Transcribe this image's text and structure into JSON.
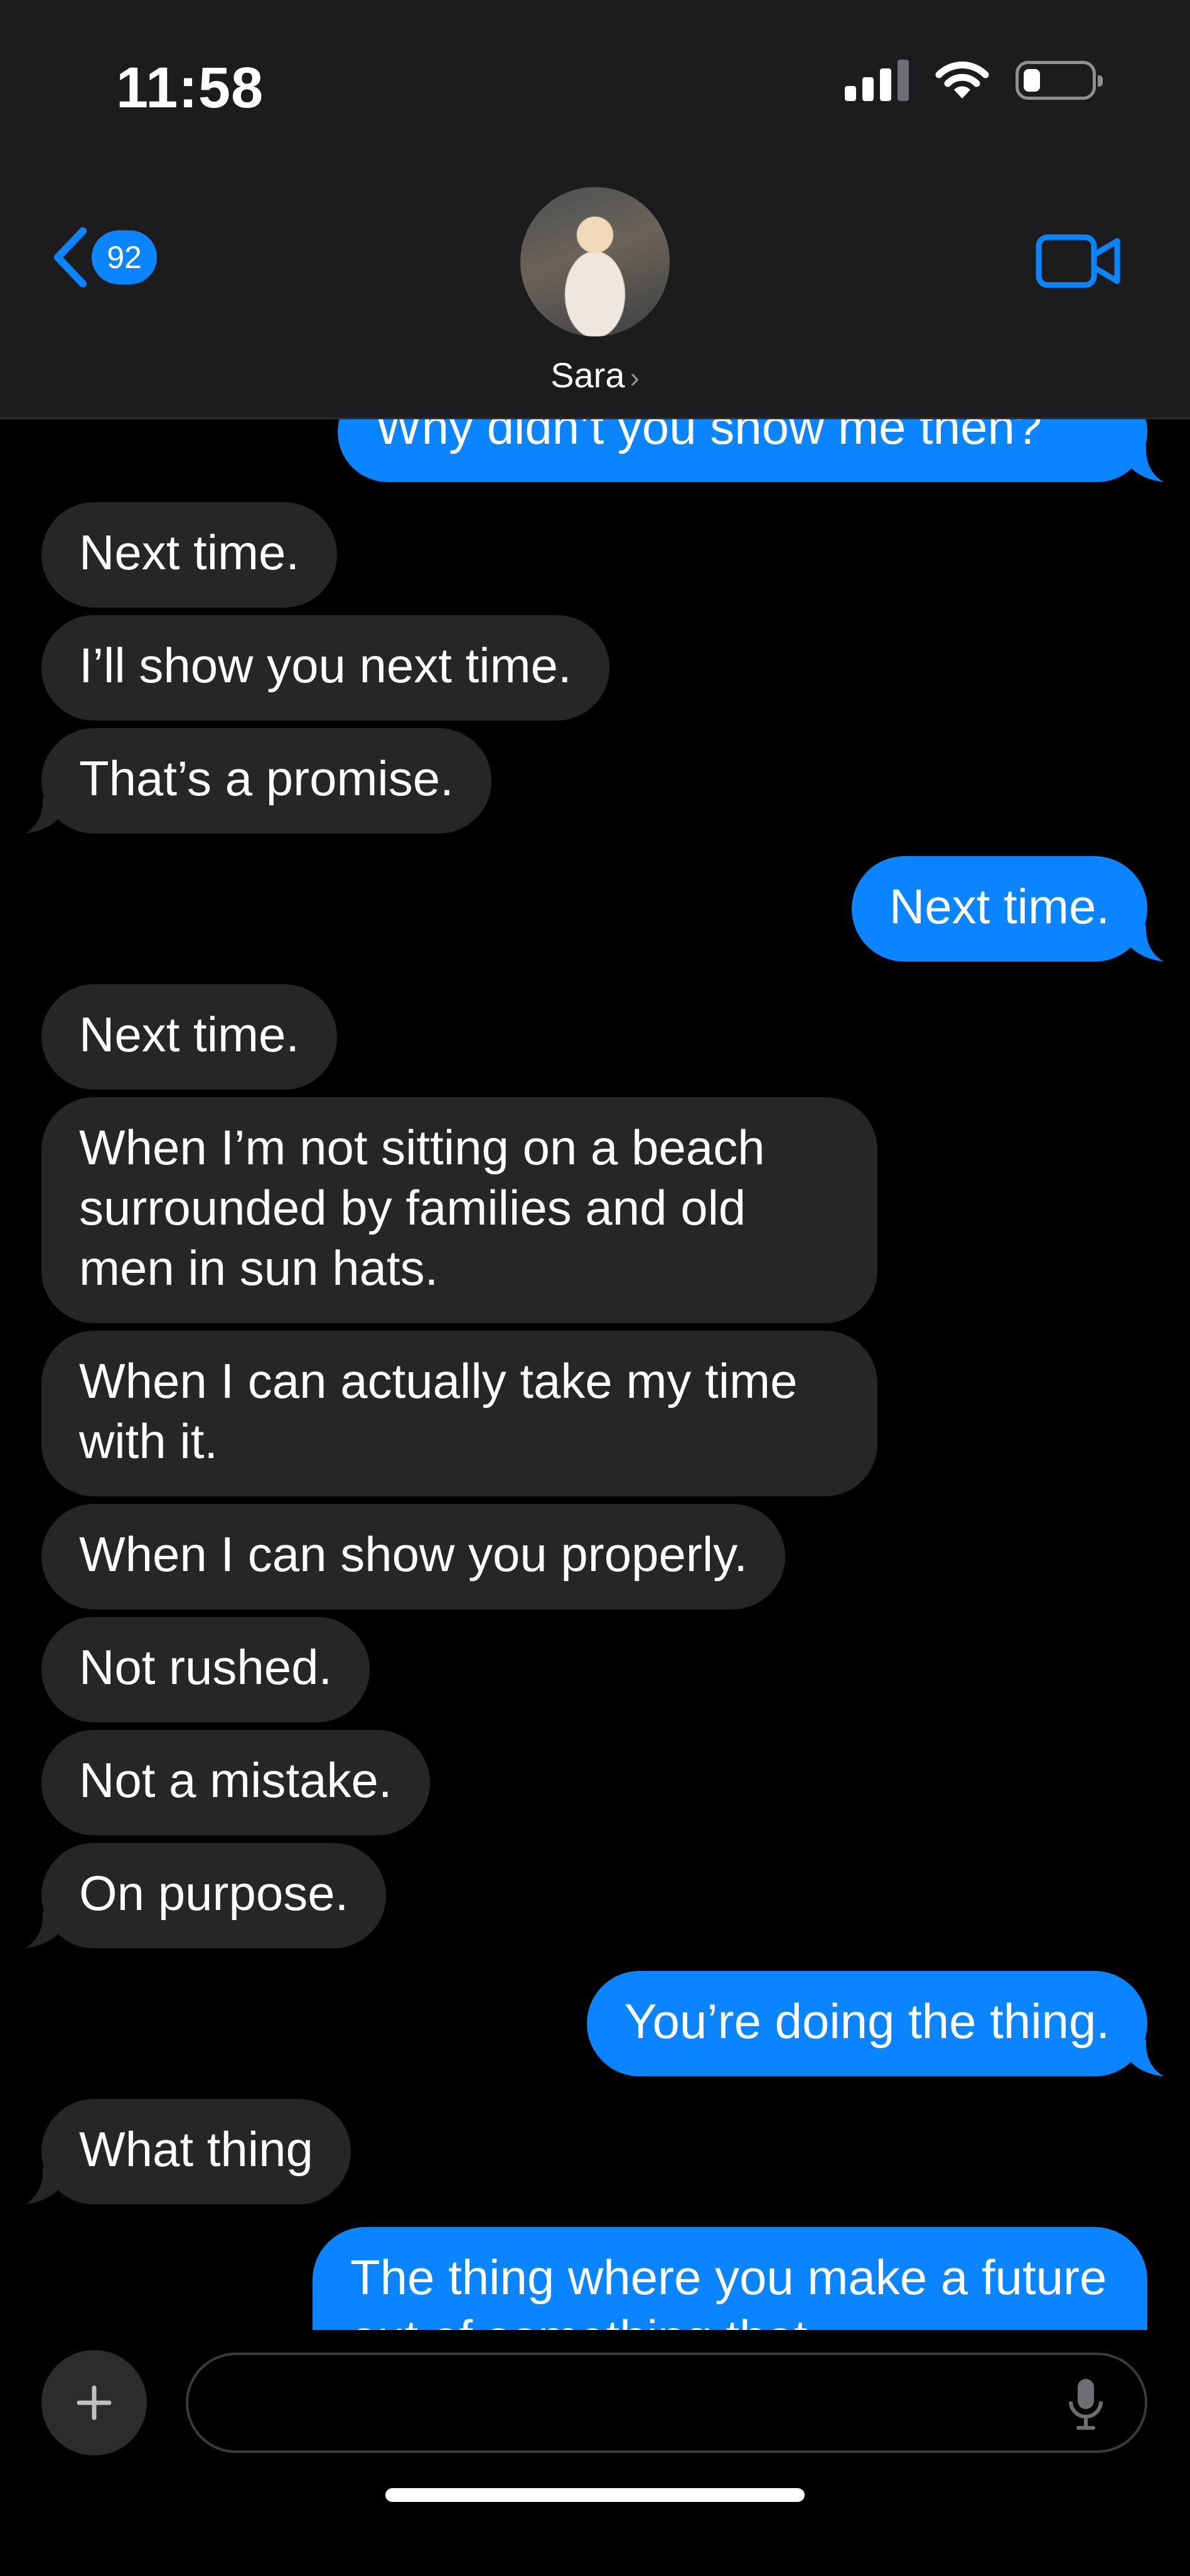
{
  "status_bar": {
    "time": "11:58"
  },
  "header": {
    "back_badge": "92",
    "contact_name": "Sara",
    "accent_color": "#0a84ff"
  },
  "messages": [
    {
      "dir": "out",
      "text": "Why didn’t you show me then?"
    },
    {
      "dir": "in",
      "text": "Next time."
    },
    {
      "dir": "in",
      "text": "I’ll show you next time."
    },
    {
      "dir": "in",
      "text": "That’s a promise."
    },
    {
      "dir": "out",
      "text": "Next time."
    },
    {
      "dir": "in",
      "text": "Next time."
    },
    {
      "dir": "in",
      "text": "When I’m not sitting on a beach surrounded by families and old men in sun hats."
    },
    {
      "dir": "in",
      "text": "When I can actually take my time with it."
    },
    {
      "dir": "in",
      "text": "When I can show you properly."
    },
    {
      "dir": "in",
      "text": "Not rushed."
    },
    {
      "dir": "in",
      "text": "Not a mistake."
    },
    {
      "dir": "in",
      "text": "On purpose."
    },
    {
      "dir": "out",
      "text": "You’re doing the thing."
    },
    {
      "dir": "in",
      "text": "What thing"
    },
    {
      "dir": "out",
      "text": "The thing where you make a future out of something that"
    }
  ],
  "composer": {
    "placeholder": ""
  },
  "icons": [
    "back-chevron-icon",
    "video-camera-icon",
    "plus-icon",
    "microphone-icon",
    "cellular-signal-icon",
    "wifi-icon",
    "battery-icon"
  ]
}
